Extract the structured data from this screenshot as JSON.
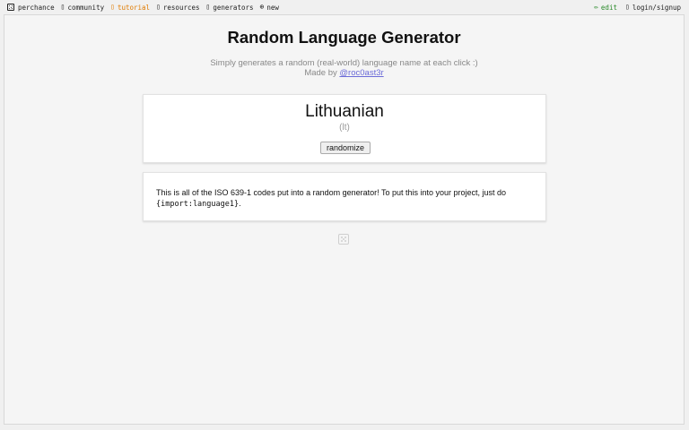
{
  "nav": {
    "site": "perchance",
    "community": "community",
    "tutorial": "tutorial",
    "resources": "resources",
    "generators": "generators",
    "new": "new",
    "edit": "edit",
    "login": "login/signup"
  },
  "icons": {
    "community": "people-icon",
    "tutorial": "book-icon",
    "resources": "toolbox-icon",
    "generators": "grid-icon",
    "new": "plus-circle-icon",
    "edit": "pencil-icon",
    "login": "user-icon"
  },
  "colors": {
    "tutorial": "#e07b00",
    "edit": "#2a8a2a",
    "link": "#6b6bd8"
  },
  "page": {
    "title": "Random Language Generator",
    "subtitle": "Simply generates a random (real-world) language name at each click :)",
    "made_by_prefix": "Made by ",
    "author": "@roc0ast3r"
  },
  "result": {
    "name": "Lithuanian",
    "code": "(lt)",
    "button_label": "randomize"
  },
  "info": {
    "text_before": "This is all of the ISO 639-1 codes put into a random generator! To put this into your project, just do ",
    "code": "{import:language1}",
    "text_after": "."
  }
}
